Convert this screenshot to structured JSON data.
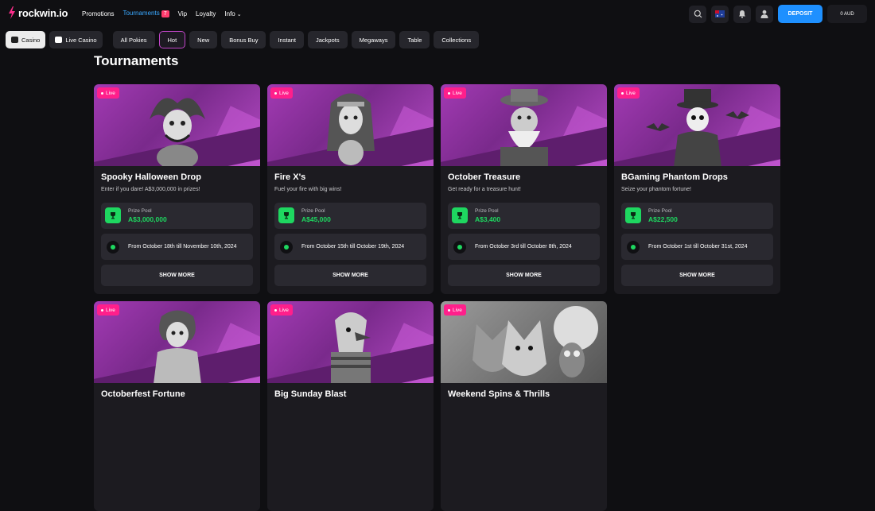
{
  "brand": {
    "name": "rockwin.io"
  },
  "nav": {
    "promotions": "Promotions",
    "tournaments": "Tournaments",
    "tournaments_badge": "7",
    "vip": "Vip",
    "loyalty": "Loyalty",
    "info": "Info",
    "info_chevron": "⌄"
  },
  "header": {
    "deposit": "DEPOSIT",
    "balance": "0 AUD"
  },
  "filters": {
    "casino": "Casino",
    "live_casino": "Live Casino",
    "chips": [
      "All Pokies",
      "Hot",
      "New",
      "Bonus Buy",
      "Instant",
      "Jackpots",
      "Megaways",
      "Table",
      "Collections"
    ]
  },
  "page": {
    "title": "Tournaments"
  },
  "colors": {
    "accent": "#1e90ff",
    "live": "#ff1f8b",
    "prize": "#1ed760",
    "banner": "#a23ab3"
  },
  "cards": [
    {
      "live": "Live",
      "title": "Spooky Halloween Drop",
      "subtitle": "Enter if you dare! A$3,000,000 in prizes!",
      "prize_label": "Prize Pool",
      "prize": "A$3,000,000",
      "date": "From October 18th till November 10th, 2024",
      "show_more": "SHOW MORE"
    },
    {
      "live": "Live",
      "title": "Fire X's",
      "subtitle": "Fuel your fire with big wins!",
      "prize_label": "Prize Pool",
      "prize": "A$45,000",
      "date": "From October 15th till October 19th, 2024",
      "show_more": "SHOW MORE"
    },
    {
      "live": "Live",
      "title": "October Treasure",
      "subtitle": "Get ready for a treasure hunt!",
      "prize_label": "Prize Pool",
      "prize": "A$3,400",
      "date": "From October 3rd till October 8th, 2024",
      "show_more": "SHOW MORE"
    },
    {
      "live": "Live",
      "title": "BGaming Phantom Drops",
      "subtitle": "Seize your phantom fortune!",
      "prize_label": "Prize Pool",
      "prize": "A$22,500",
      "date": "From October 1st till October 31st, 2024",
      "show_more": "SHOW MORE"
    },
    {
      "live": "Live",
      "title": "Octoberfest Fortune"
    },
    {
      "live": "Live",
      "title": "Big Sunday Blast"
    },
    {
      "live": "Live",
      "title": "Weekend Spins & Thrills"
    }
  ]
}
